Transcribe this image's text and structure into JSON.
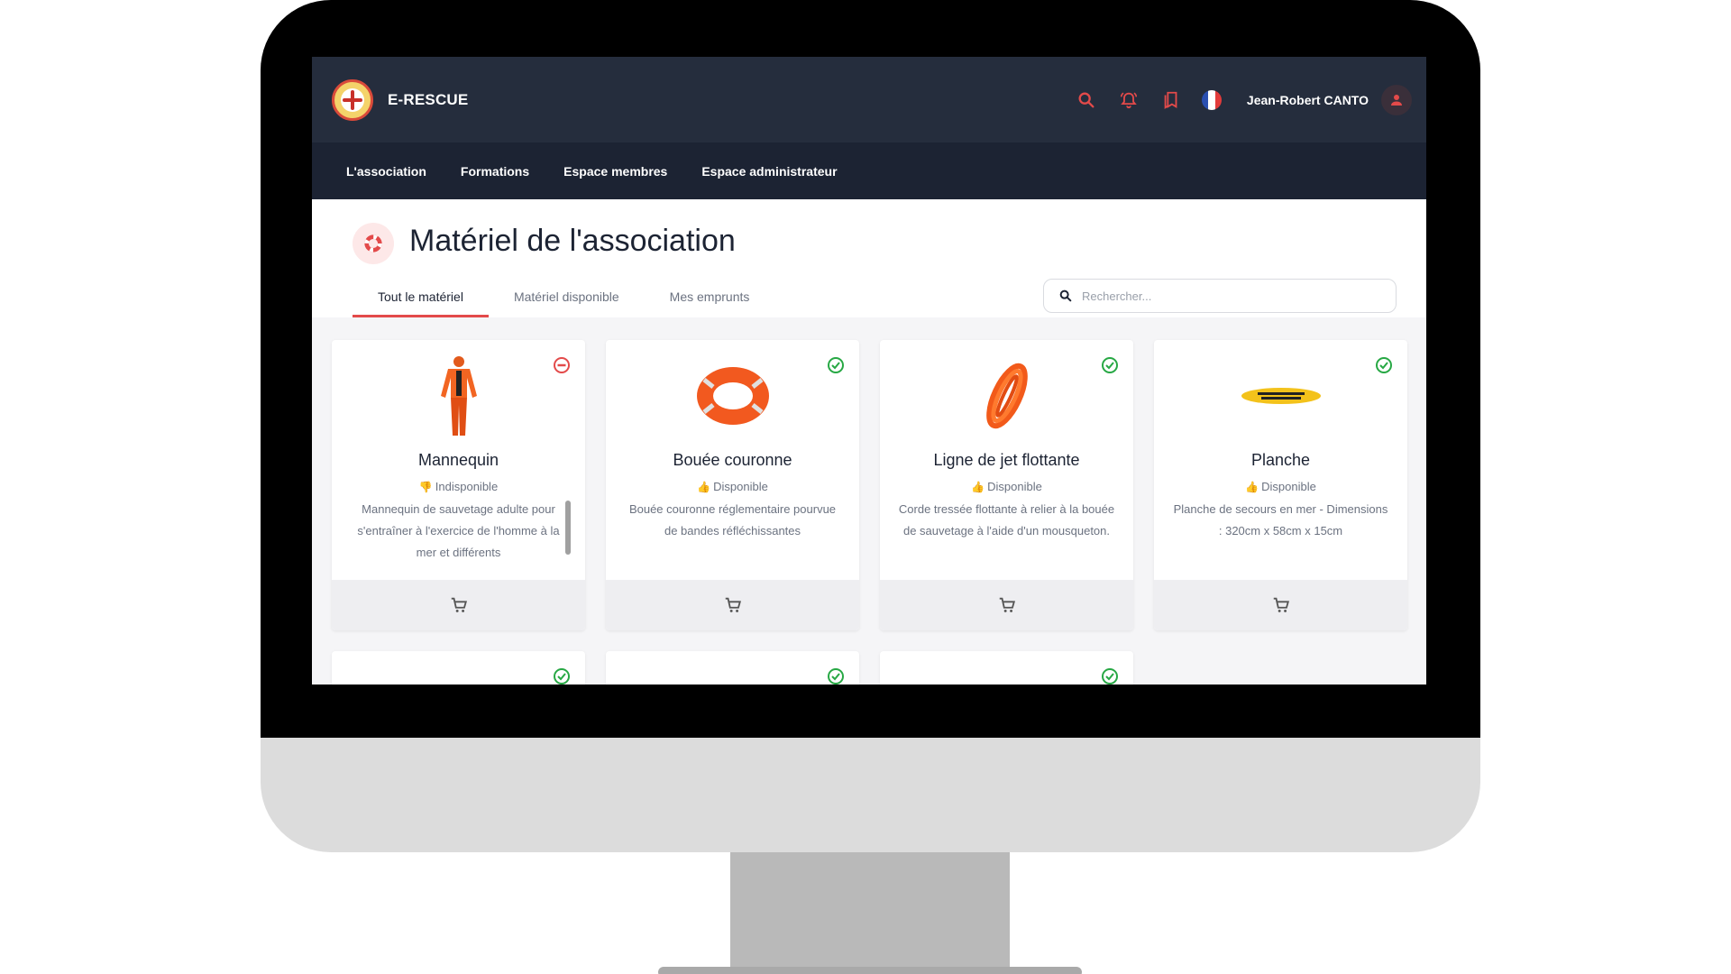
{
  "app": {
    "name": "E-RESCUE"
  },
  "user": {
    "name": "Jean-Robert CANTO"
  },
  "nav": {
    "items": [
      "L'association",
      "Formations",
      "Espace membres",
      "Espace administrateur"
    ]
  },
  "page": {
    "title": "Matériel de l'association"
  },
  "tabs": [
    "Tout le matériel",
    "Matériel disponible",
    "Mes emprunts"
  ],
  "search": {
    "placeholder": "Rechercher..."
  },
  "cards": [
    {
      "title": "Mannequin",
      "status": "Indisponible",
      "available": false,
      "description": "Mannequin de sauvetage adulte pour s'entraîner à l'exercice de l'homme à la mer et différents"
    },
    {
      "title": "Bouée couronne",
      "status": "Disponible",
      "available": true,
      "description": "Bouée couronne réglementaire pourvue de bandes réfléchissantes"
    },
    {
      "title": "Ligne de jet flottante",
      "status": "Disponible",
      "available": true,
      "description": "Corde tressée flottante à relier à la bouée de sauvetage à l'aide d'un mousqueton."
    },
    {
      "title": "Planche",
      "status": "Disponible",
      "available": true,
      "description": "Planche de secours en mer - Dimensions : 320cm x 58cm x 15cm"
    }
  ],
  "colors": {
    "accent": "#e34a4a",
    "topbar": "#252d3d",
    "navbar": "#1c2333",
    "available": "#27a844"
  }
}
